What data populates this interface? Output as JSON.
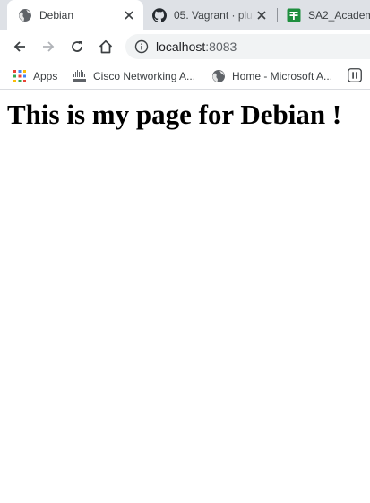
{
  "tabs": [
    {
      "title": "Debian",
      "icon": "globe-icon",
      "active": true
    },
    {
      "title": "05. Vagrant · plu",
      "icon": "github-icon",
      "active": false
    },
    {
      "title": "SA2_Academ",
      "icon": "sheets-icon",
      "active": false
    }
  ],
  "toolbar": {
    "url_host": "localhost",
    "url_port": ":8083"
  },
  "bookmarks": [
    {
      "label": "Apps",
      "icon": "apps-grid-icon"
    },
    {
      "label": "Cisco Networking A...",
      "icon": "cisco-icon"
    },
    {
      "label": "Home - Microsoft A...",
      "icon": "globe-icon"
    }
  ],
  "page": {
    "heading": "This is my page for Debian !"
  },
  "colors": {
    "tabstrip": "#dee1e6",
    "omnibox": "#f1f3f4",
    "sheets_green": "#1e8e3e"
  }
}
